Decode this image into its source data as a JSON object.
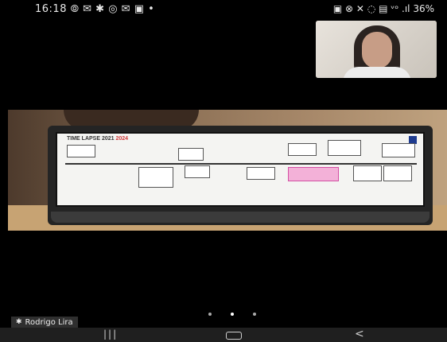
{
  "status_bar": {
    "time": "16:18",
    "left_icons": "⦾ ✉ ✱ ◎ ✉ ▣ •",
    "right_icons": "▣ ⊗ ✕ ◌ ▤ ᵛᵒ",
    "signal": ".ıl",
    "battery": "36%"
  },
  "call": {
    "participant_name": "Rodrigo Lira"
  },
  "slide": {
    "title_part1": "TIME LAPSE 2021",
    "title_part2": "2024"
  },
  "colors": {
    "accent_highlight": "#f3b1d8",
    "slide_blue": "#1e3b8f",
    "slide_title_red": "#d03a3a"
  },
  "icons": [
    "pin-icon",
    "recent-apps-icon",
    "home-icon",
    "back-icon"
  ],
  "nav_bar": {
    "recents_glyph": "|||",
    "back_glyph": "<"
  },
  "page_indicator": {
    "count": 3,
    "active_index": 1
  }
}
